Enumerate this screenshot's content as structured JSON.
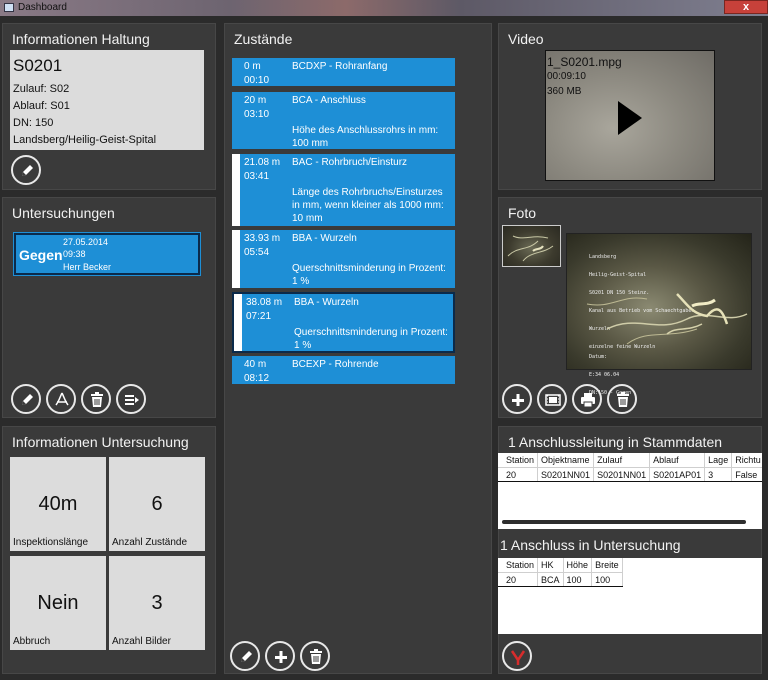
{
  "window": {
    "title": "Dashboard",
    "close": "x"
  },
  "haltung": {
    "title": "Informationen Haltung",
    "id": "S0201",
    "zulauf": "Zulauf: S02",
    "ablauf": "Ablauf: S01",
    "dn": "DN: 150",
    "ort": "Landsberg/Heilig-Geist-Spital"
  },
  "untersuchungen": {
    "title": "Untersuchungen",
    "card": {
      "name": "Gegen",
      "date": "27.05.2014",
      "time": "09:38",
      "person": "Herr Becker"
    }
  },
  "info_untersuchung": {
    "title": "Informationen Untersuchung",
    "tiles": [
      {
        "value": "40m",
        "label": "Inspektionslänge"
      },
      {
        "value": "6",
        "label": "Anzahl Zustände"
      },
      {
        "value": "Nein",
        "label": "Abbruch"
      },
      {
        "value": "3",
        "label": "Anzahl Bilder"
      }
    ]
  },
  "zustaende": {
    "title": "Zustände",
    "items": [
      {
        "meter": "0 m",
        "time": "00:10",
        "code": "BCDXP - Rohranfang",
        "desc": ""
      },
      {
        "meter": "20 m",
        "time": "03:10",
        "code": "BCA - Anschluss",
        "desc": "Höhe des Anschlussrohrs in mm: 100 mm"
      },
      {
        "meter": "21.08 m",
        "time": "03:41",
        "code": "BAC - Rohrbruch/Einsturz",
        "desc": "Länge des Rohrbruchs/Einsturzes in mm, wenn kleiner als 1000 mm: 10 mm"
      },
      {
        "meter": "33.93 m",
        "time": "05:54",
        "code": "BBA - Wurzeln",
        "desc": "Querschnittsminderung in Prozent: 1 %"
      },
      {
        "meter": "38.08 m",
        "time": "07:21",
        "code": "BBA - Wurzeln",
        "desc": "Querschnittsminderung in Prozent: 1 %"
      },
      {
        "meter": "40 m",
        "time": "08:12",
        "code": "BCEXP - Rohrende",
        "desc": ""
      }
    ]
  },
  "video": {
    "title": "Video",
    "filename": "1_S0201.mpg",
    "duration": "00:09:10",
    "size": "360 MB"
  },
  "foto": {
    "title": "Foto",
    "overlay_lines": [
      "Landsberg",
      "Heilig-Geist-Spital",
      "S0201 DN 150 Steinz.",
      "Kanal aus Betrieb vom Schaechtgaben",
      "Wurzeln",
      "einzelne feine Wurzeln"
    ],
    "overlay_bottom": [
      "Datum:",
      "E:34 06.04",
      "DN:150 - Gegen"
    ]
  },
  "anschlussleitung": {
    "title": "1 Anschlussleitung in Stammdaten",
    "columns": [
      "Station",
      "Objektname",
      "Zulauf",
      "Ablauf",
      "Lage",
      "Richtu"
    ],
    "rows": [
      [
        "20",
        "S0201NN01",
        "S0201NN01",
        "S0201AP01",
        "3",
        "False"
      ]
    ]
  },
  "anschluss": {
    "title": "1 Anschluss in Untersuchung",
    "columns": [
      "Station",
      "HK",
      "Höhe",
      "Breite"
    ],
    "rows": [
      [
        "20",
        "BCA",
        "100",
        "100"
      ]
    ]
  },
  "colors": {
    "panel": "#3a3a3a",
    "accent": "#1e8fd6",
    "tile": "#dcdcdc"
  }
}
